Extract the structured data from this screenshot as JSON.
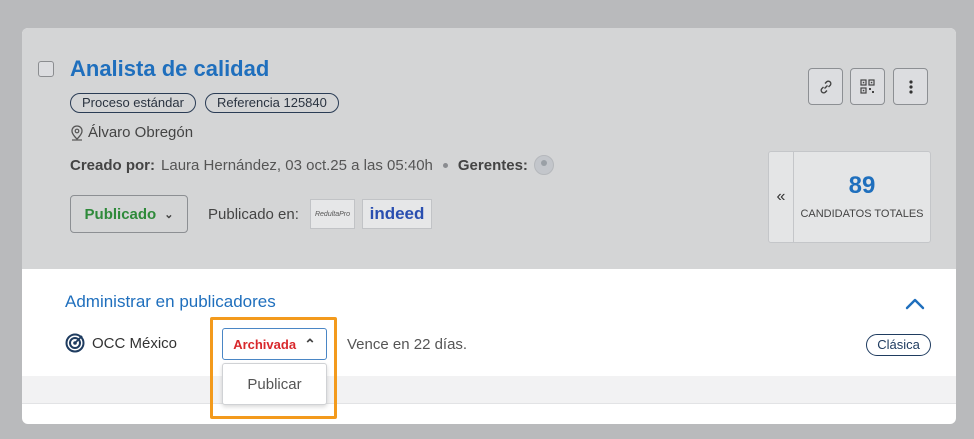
{
  "job": {
    "title": "Analista de calidad",
    "tags": [
      "Proceso estándar",
      "Referencia 125840"
    ],
    "location": "Álvaro Obregón",
    "created_by_label": "Creado por:",
    "created_by_value": "Laura Hernández, 03 oct.25 a las 05:40h",
    "managers_label": "Gerentes:",
    "status_label": "Publicado",
    "published_on_label": "Publicado en:",
    "publishers": [
      "RedultaPro",
      "indeed"
    ]
  },
  "actions": {
    "link_icon": "link-icon",
    "qr_icon": "qr-code-icon",
    "more_icon": "more-vertical-icon"
  },
  "candidates": {
    "count": "89",
    "label": "CANDIDATOS TOTALES",
    "collapse_glyph": "«"
  },
  "admin": {
    "title": "Administrar en publicadores",
    "publisher_name": "OCC México",
    "publisher_status": "Archivada",
    "expires_text": "Vence en 22 días.",
    "plan_badge": "Clásica",
    "dropdown_options": [
      "Publicar"
    ]
  },
  "colors": {
    "accent": "#1f6fbd",
    "published_green": "#2e8a3a",
    "archived_red": "#d8282c",
    "highlight_orange": "#f39a1c"
  }
}
